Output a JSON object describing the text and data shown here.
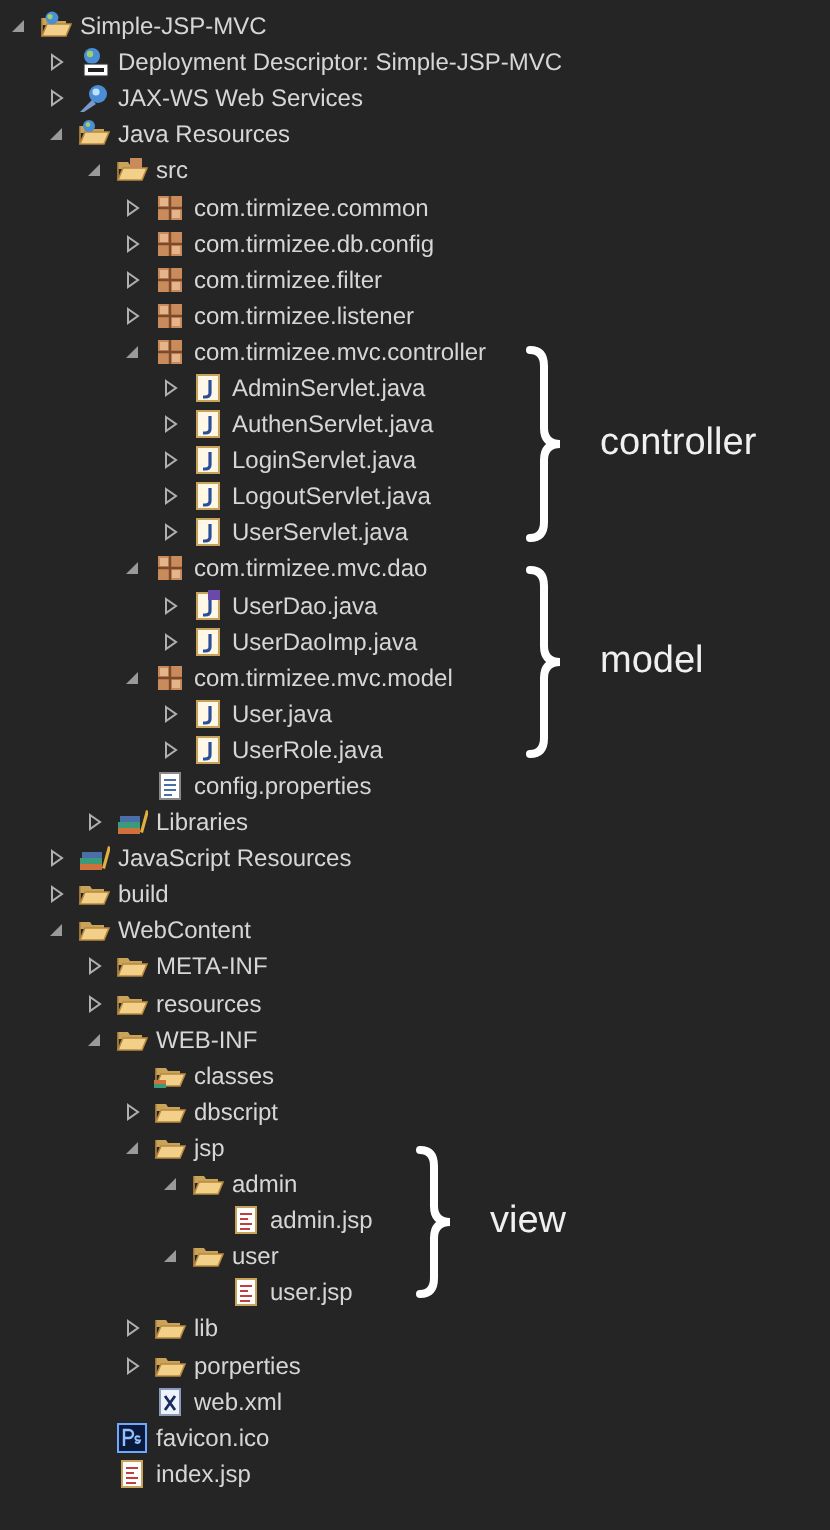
{
  "tree": [
    {
      "label": "Simple-JSP-MVC",
      "kind": "project",
      "expanded": true,
      "children": [
        {
          "label": "Deployment Descriptor: Simple-JSP-MVC",
          "kind": "descriptor",
          "expanded": false
        },
        {
          "label": "JAX-WS Web Services",
          "kind": "webservices",
          "expanded": false
        },
        {
          "label": "Java Resources",
          "kind": "resources",
          "expanded": true,
          "children": [
            {
              "label": "src",
              "kind": "source-folder",
              "expanded": true,
              "children": [
                {
                  "label": "com.tirmizee.common",
                  "kind": "package",
                  "expanded": false
                },
                {
                  "label": "com.tirmizee.db.config",
                  "kind": "package",
                  "expanded": false
                },
                {
                  "label": "com.tirmizee.filter",
                  "kind": "package",
                  "expanded": false
                },
                {
                  "label": "com.tirmizee.listener",
                  "kind": "package",
                  "expanded": false
                },
                {
                  "label": "com.tirmizee.mvc.controller",
                  "kind": "package",
                  "expanded": true,
                  "children": [
                    {
                      "label": "AdminServlet.java",
                      "kind": "java",
                      "expanded": false
                    },
                    {
                      "label": "AuthenServlet.java",
                      "kind": "java",
                      "expanded": false
                    },
                    {
                      "label": "LoginServlet.java",
                      "kind": "java",
                      "expanded": false
                    },
                    {
                      "label": "LogoutServlet.java",
                      "kind": "java",
                      "expanded": false
                    },
                    {
                      "label": "UserServlet.java",
                      "kind": "java",
                      "expanded": false
                    }
                  ]
                },
                {
                  "label": "com.tirmizee.mvc.dao",
                  "kind": "package",
                  "expanded": true,
                  "children": [
                    {
                      "label": "UserDao.java",
                      "kind": "interface",
                      "expanded": false
                    },
                    {
                      "label": "UserDaoImp.java",
                      "kind": "java",
                      "expanded": false
                    }
                  ]
                },
                {
                  "label": "com.tirmizee.mvc.model",
                  "kind": "package",
                  "expanded": true,
                  "children": [
                    {
                      "label": "User.java",
                      "kind": "java",
                      "expanded": false
                    },
                    {
                      "label": "UserRole.java",
                      "kind": "java",
                      "expanded": false
                    }
                  ]
                },
                {
                  "label": "config.properties",
                  "kind": "text-file"
                }
              ]
            },
            {
              "label": "Libraries",
              "kind": "library",
              "expanded": false
            }
          ]
        },
        {
          "label": "JavaScript Resources",
          "kind": "library",
          "expanded": false
        },
        {
          "label": "build",
          "kind": "folder",
          "expanded": false
        },
        {
          "label": "WebContent",
          "kind": "folder",
          "expanded": true,
          "children": [
            {
              "label": "META-INF",
              "kind": "folder",
              "expanded": false
            },
            {
              "label": "resources",
              "kind": "folder",
              "expanded": false
            },
            {
              "label": "WEB-INF",
              "kind": "folder",
              "expanded": true,
              "children": [
                {
                  "label": "classes",
                  "kind": "classes-folder"
                },
                {
                  "label": "dbscript",
                  "kind": "folder",
                  "expanded": false
                },
                {
                  "label": "jsp",
                  "kind": "folder",
                  "expanded": true,
                  "children": [
                    {
                      "label": "admin",
                      "kind": "folder",
                      "expanded": true,
                      "children": [
                        {
                          "label": "admin.jsp",
                          "kind": "jsp"
                        }
                      ]
                    },
                    {
                      "label": "user",
                      "kind": "folder",
                      "expanded": true,
                      "children": [
                        {
                          "label": "user.jsp",
                          "kind": "jsp"
                        }
                      ]
                    }
                  ]
                },
                {
                  "label": "lib",
                  "kind": "folder",
                  "expanded": false
                },
                {
                  "label": "porperties",
                  "kind": "folder",
                  "expanded": false
                },
                {
                  "label": "web.xml",
                  "kind": "xml"
                }
              ]
            },
            {
              "label": "favicon.ico",
              "kind": "image"
            },
            {
              "label": "index.jsp",
              "kind": "jsp"
            }
          ]
        }
      ]
    }
  ],
  "annotations": [
    {
      "label": "controller"
    },
    {
      "label": "model"
    },
    {
      "label": "view"
    }
  ]
}
